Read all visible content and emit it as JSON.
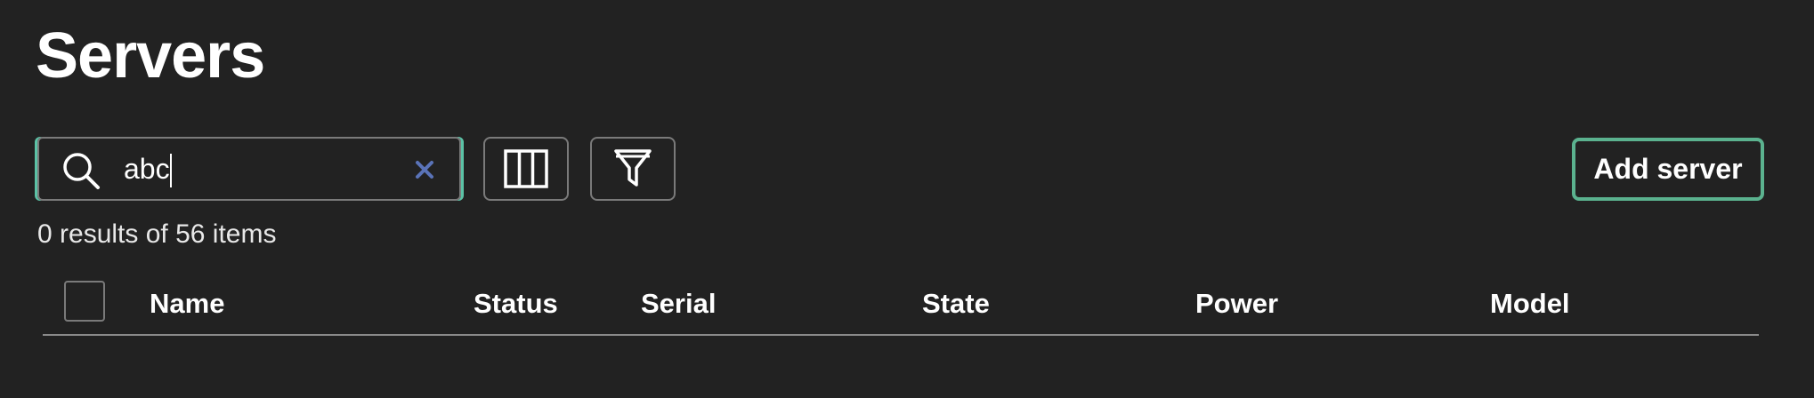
{
  "page": {
    "title": "Servers"
  },
  "toolbar": {
    "search_value": "abc",
    "search_icon": "search-icon",
    "clear_icon": "close-icon",
    "columns_icon": "columns-icon",
    "filter_icon": "filter-icon",
    "add_label": "Add server"
  },
  "results": {
    "summary": "0 results of 56 items"
  },
  "table": {
    "columns": [
      "Name",
      "Status",
      "Serial",
      "State",
      "Power",
      "Model"
    ],
    "rows": []
  },
  "colors": {
    "background": "#222222",
    "accent": "#5bb28f",
    "focus": "#5bc2a6",
    "clear_icon": "#5a73b8",
    "border": "#7a7a7a"
  }
}
